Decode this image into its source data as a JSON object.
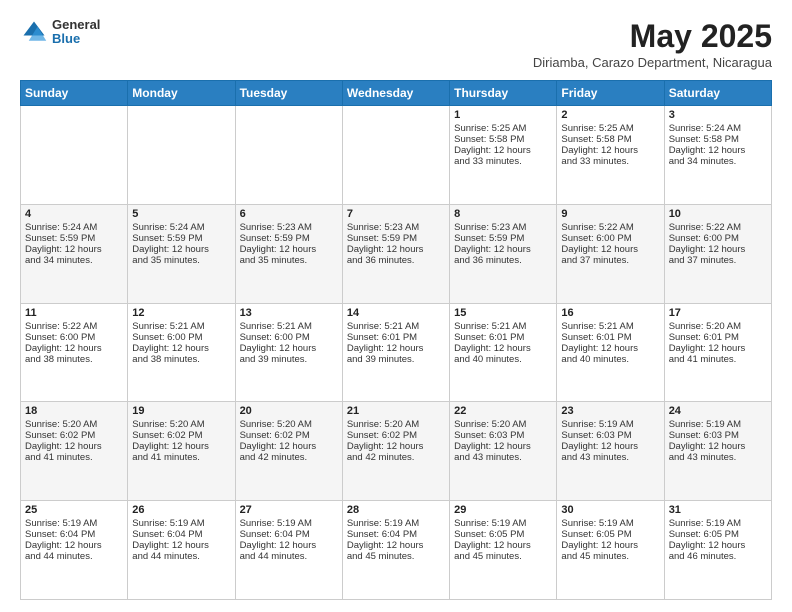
{
  "header": {
    "logo_general": "General",
    "logo_blue": "Blue",
    "month": "May 2025",
    "location": "Diriamba, Carazo Department, Nicaragua"
  },
  "weekdays": [
    "Sunday",
    "Monday",
    "Tuesday",
    "Wednesday",
    "Thursday",
    "Friday",
    "Saturday"
  ],
  "weeks": [
    [
      {
        "day": "",
        "info": ""
      },
      {
        "day": "",
        "info": ""
      },
      {
        "day": "",
        "info": ""
      },
      {
        "day": "",
        "info": ""
      },
      {
        "day": "1",
        "info": "Sunrise: 5:25 AM\nSunset: 5:58 PM\nDaylight: 12 hours\nand 33 minutes."
      },
      {
        "day": "2",
        "info": "Sunrise: 5:25 AM\nSunset: 5:58 PM\nDaylight: 12 hours\nand 33 minutes."
      },
      {
        "day": "3",
        "info": "Sunrise: 5:24 AM\nSunset: 5:58 PM\nDaylight: 12 hours\nand 34 minutes."
      }
    ],
    [
      {
        "day": "4",
        "info": "Sunrise: 5:24 AM\nSunset: 5:59 PM\nDaylight: 12 hours\nand 34 minutes."
      },
      {
        "day": "5",
        "info": "Sunrise: 5:24 AM\nSunset: 5:59 PM\nDaylight: 12 hours\nand 35 minutes."
      },
      {
        "day": "6",
        "info": "Sunrise: 5:23 AM\nSunset: 5:59 PM\nDaylight: 12 hours\nand 35 minutes."
      },
      {
        "day": "7",
        "info": "Sunrise: 5:23 AM\nSunset: 5:59 PM\nDaylight: 12 hours\nand 36 minutes."
      },
      {
        "day": "8",
        "info": "Sunrise: 5:23 AM\nSunset: 5:59 PM\nDaylight: 12 hours\nand 36 minutes."
      },
      {
        "day": "9",
        "info": "Sunrise: 5:22 AM\nSunset: 6:00 PM\nDaylight: 12 hours\nand 37 minutes."
      },
      {
        "day": "10",
        "info": "Sunrise: 5:22 AM\nSunset: 6:00 PM\nDaylight: 12 hours\nand 37 minutes."
      }
    ],
    [
      {
        "day": "11",
        "info": "Sunrise: 5:22 AM\nSunset: 6:00 PM\nDaylight: 12 hours\nand 38 minutes."
      },
      {
        "day": "12",
        "info": "Sunrise: 5:21 AM\nSunset: 6:00 PM\nDaylight: 12 hours\nand 38 minutes."
      },
      {
        "day": "13",
        "info": "Sunrise: 5:21 AM\nSunset: 6:00 PM\nDaylight: 12 hours\nand 39 minutes."
      },
      {
        "day": "14",
        "info": "Sunrise: 5:21 AM\nSunset: 6:01 PM\nDaylight: 12 hours\nand 39 minutes."
      },
      {
        "day": "15",
        "info": "Sunrise: 5:21 AM\nSunset: 6:01 PM\nDaylight: 12 hours\nand 40 minutes."
      },
      {
        "day": "16",
        "info": "Sunrise: 5:21 AM\nSunset: 6:01 PM\nDaylight: 12 hours\nand 40 minutes."
      },
      {
        "day": "17",
        "info": "Sunrise: 5:20 AM\nSunset: 6:01 PM\nDaylight: 12 hours\nand 41 minutes."
      }
    ],
    [
      {
        "day": "18",
        "info": "Sunrise: 5:20 AM\nSunset: 6:02 PM\nDaylight: 12 hours\nand 41 minutes."
      },
      {
        "day": "19",
        "info": "Sunrise: 5:20 AM\nSunset: 6:02 PM\nDaylight: 12 hours\nand 41 minutes."
      },
      {
        "day": "20",
        "info": "Sunrise: 5:20 AM\nSunset: 6:02 PM\nDaylight: 12 hours\nand 42 minutes."
      },
      {
        "day": "21",
        "info": "Sunrise: 5:20 AM\nSunset: 6:02 PM\nDaylight: 12 hours\nand 42 minutes."
      },
      {
        "day": "22",
        "info": "Sunrise: 5:20 AM\nSunset: 6:03 PM\nDaylight: 12 hours\nand 43 minutes."
      },
      {
        "day": "23",
        "info": "Sunrise: 5:19 AM\nSunset: 6:03 PM\nDaylight: 12 hours\nand 43 minutes."
      },
      {
        "day": "24",
        "info": "Sunrise: 5:19 AM\nSunset: 6:03 PM\nDaylight: 12 hours\nand 43 minutes."
      }
    ],
    [
      {
        "day": "25",
        "info": "Sunrise: 5:19 AM\nSunset: 6:04 PM\nDaylight: 12 hours\nand 44 minutes."
      },
      {
        "day": "26",
        "info": "Sunrise: 5:19 AM\nSunset: 6:04 PM\nDaylight: 12 hours\nand 44 minutes."
      },
      {
        "day": "27",
        "info": "Sunrise: 5:19 AM\nSunset: 6:04 PM\nDaylight: 12 hours\nand 44 minutes."
      },
      {
        "day": "28",
        "info": "Sunrise: 5:19 AM\nSunset: 6:04 PM\nDaylight: 12 hours\nand 45 minutes."
      },
      {
        "day": "29",
        "info": "Sunrise: 5:19 AM\nSunset: 6:05 PM\nDaylight: 12 hours\nand 45 minutes."
      },
      {
        "day": "30",
        "info": "Sunrise: 5:19 AM\nSunset: 6:05 PM\nDaylight: 12 hours\nand 45 minutes."
      },
      {
        "day": "31",
        "info": "Sunrise: 5:19 AM\nSunset: 6:05 PM\nDaylight: 12 hours\nand 46 minutes."
      }
    ]
  ]
}
